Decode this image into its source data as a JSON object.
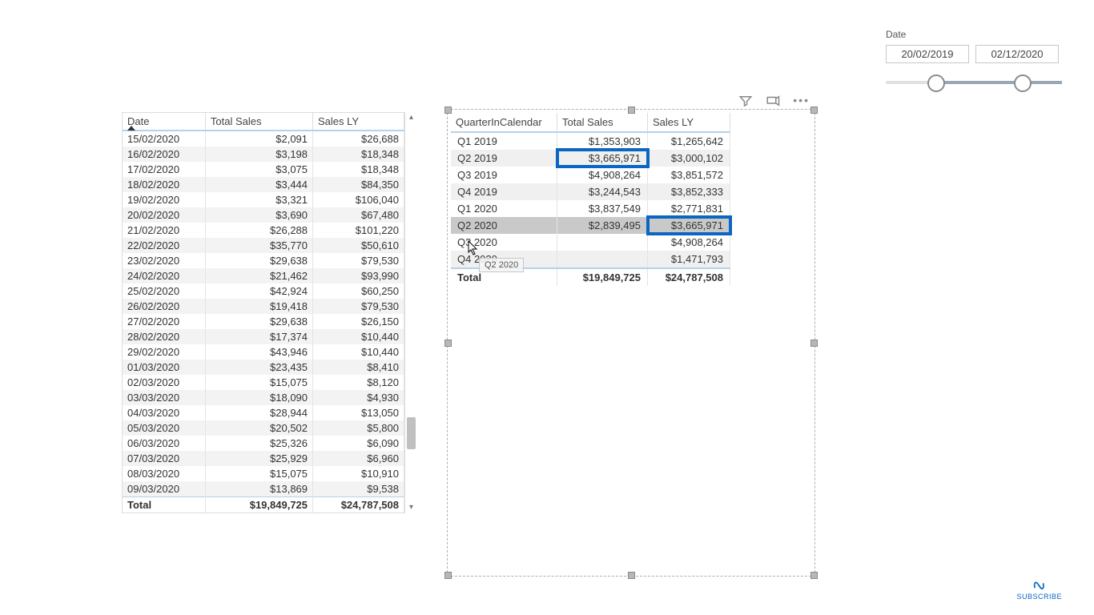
{
  "slicer": {
    "title": "Date",
    "from": "20/02/2019",
    "to": "02/12/2020"
  },
  "left_table": {
    "cols": [
      "Date",
      "Total Sales",
      "Sales LY"
    ],
    "rows": [
      {
        "date": "15/02/2020",
        "ts": "$2,091",
        "ly": "$26,688"
      },
      {
        "date": "16/02/2020",
        "ts": "$3,198",
        "ly": "$18,348"
      },
      {
        "date": "17/02/2020",
        "ts": "$3,075",
        "ly": "$18,348"
      },
      {
        "date": "18/02/2020",
        "ts": "$3,444",
        "ly": "$84,350"
      },
      {
        "date": "19/02/2020",
        "ts": "$3,321",
        "ly": "$106,040"
      },
      {
        "date": "20/02/2020",
        "ts": "$3,690",
        "ly": "$67,480"
      },
      {
        "date": "21/02/2020",
        "ts": "$26,288",
        "ly": "$101,220"
      },
      {
        "date": "22/02/2020",
        "ts": "$35,770",
        "ly": "$50,610"
      },
      {
        "date": "23/02/2020",
        "ts": "$29,638",
        "ly": "$79,530"
      },
      {
        "date": "24/02/2020",
        "ts": "$21,462",
        "ly": "$93,990"
      },
      {
        "date": "25/02/2020",
        "ts": "$42,924",
        "ly": "$60,250"
      },
      {
        "date": "26/02/2020",
        "ts": "$19,418",
        "ly": "$79,530"
      },
      {
        "date": "27/02/2020",
        "ts": "$29,638",
        "ly": "$26,150"
      },
      {
        "date": "28/02/2020",
        "ts": "$17,374",
        "ly": "$10,440"
      },
      {
        "date": "29/02/2020",
        "ts": "$43,946",
        "ly": "$10,440"
      },
      {
        "date": "01/03/2020",
        "ts": "$23,435",
        "ly": "$8,410"
      },
      {
        "date": "02/03/2020",
        "ts": "$15,075",
        "ly": "$8,120"
      },
      {
        "date": "03/03/2020",
        "ts": "$18,090",
        "ly": "$4,930"
      },
      {
        "date": "04/03/2020",
        "ts": "$28,944",
        "ly": "$13,050"
      },
      {
        "date": "05/03/2020",
        "ts": "$20,502",
        "ly": "$5,800"
      },
      {
        "date": "06/03/2020",
        "ts": "$25,326",
        "ly": "$6,090"
      },
      {
        "date": "07/03/2020",
        "ts": "$25,929",
        "ly": "$6,960"
      },
      {
        "date": "08/03/2020",
        "ts": "$15,075",
        "ly": "$10,910"
      },
      {
        "date": "09/03/2020",
        "ts": "$13,869",
        "ly": "$9,538"
      }
    ],
    "total_label": "Total",
    "total_ts": "$19,849,725",
    "total_ly": "$24,787,508"
  },
  "right_table": {
    "cols": [
      "QuarterInCalendar",
      "Total Sales",
      "Sales LY"
    ],
    "rows": [
      {
        "q": "Q1 2019",
        "ts": "$1,353,903",
        "ly": "$1,265,642",
        "hl_ts": false,
        "hl_ly": false,
        "sel": false
      },
      {
        "q": "Q2 2019",
        "ts": "$3,665,971",
        "ly": "$3,000,102",
        "hl_ts": true,
        "hl_ly": false,
        "sel": false
      },
      {
        "q": "Q3 2019",
        "ts": "$4,908,264",
        "ly": "$3,851,572",
        "hl_ts": false,
        "hl_ly": false,
        "sel": false
      },
      {
        "q": "Q4 2019",
        "ts": "$3,244,543",
        "ly": "$3,852,333",
        "hl_ts": false,
        "hl_ly": false,
        "sel": false
      },
      {
        "q": "Q1 2020",
        "ts": "$3,837,549",
        "ly": "$2,771,831",
        "hl_ts": false,
        "hl_ly": false,
        "sel": false
      },
      {
        "q": "Q2 2020",
        "ts": "$2,839,495",
        "ly": "$3,665,971",
        "hl_ts": false,
        "hl_ly": true,
        "sel": true
      },
      {
        "q": "Q3 2020",
        "ts": "",
        "ly": "$4,908,264",
        "hl_ts": false,
        "hl_ly": false,
        "sel": false
      },
      {
        "q": "Q4 2020",
        "ts": "",
        "ly": "$1,471,793",
        "hl_ts": false,
        "hl_ly": false,
        "sel": false
      }
    ],
    "total_label": "Total",
    "total_ts": "$19,849,725",
    "total_ly": "$24,787,508"
  },
  "tooltip": "Q2 2020",
  "subscribe": "SUBSCRIBE"
}
